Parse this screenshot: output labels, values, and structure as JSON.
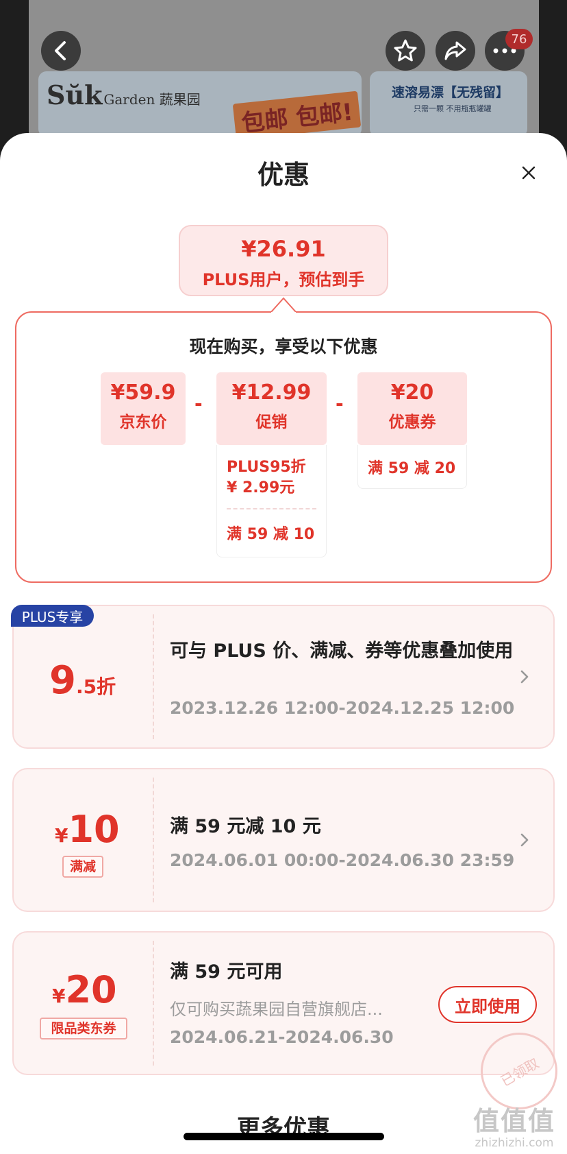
{
  "background": {
    "brand": "Sŭk",
    "brand_sub": "Garden 蔬果园",
    "promo": "包邮 包邮!",
    "banner2_title": "速溶易漂【无残留】",
    "banner2_sub": "只需一颗 不用瓶瓶罐罐",
    "cart_badge": "76"
  },
  "sheet": {
    "title": "优惠"
  },
  "estimate": {
    "price": "¥26.91",
    "label": "PLUS用户，预估到手"
  },
  "breakdown": {
    "heading": "现在购买，享受以下优惠",
    "jd_price": {
      "value": "¥59.9",
      "label": "京东价"
    },
    "promo": {
      "value": "¥12.99",
      "label": "促销",
      "detail_line1": "PLUS95折",
      "detail_line2": "¥ 2.99元",
      "detail_line3": "满 59 减 10"
    },
    "coupon": {
      "value": "¥20",
      "label": "优惠券",
      "detail": "满 59 减 20"
    },
    "minus": "-"
  },
  "cards": [
    {
      "tag": "PLUS专享",
      "amount_big": "9",
      "amount_small": ".5折",
      "title": "可与 PLUS 价、满减、券等优惠叠加使用",
      "date": "2023.12.26 12:00-2024.12.25 12:00"
    },
    {
      "currency": "¥",
      "amount": "10",
      "type": "满减",
      "title": "满 59 元减 10 元",
      "date": "2024.06.01 00:00-2024.06.30 23:59"
    },
    {
      "currency": "¥",
      "amount": "20",
      "type": "限品类东券",
      "title": "满 59 元可用",
      "desc": "仅可购买蔬果园自营旗舰店...",
      "date": "2024.06.21-2024.06.30",
      "button": "立即使用",
      "stamp": "已领取"
    }
  ],
  "more": "更多优惠",
  "watermark": {
    "line1": "值值值",
    "line2": "zhizhizhi.com"
  },
  "colors": {
    "accent": "#e0342a",
    "plus_blue": "#2743a4",
    "card_bg": "#fdf4f3"
  }
}
